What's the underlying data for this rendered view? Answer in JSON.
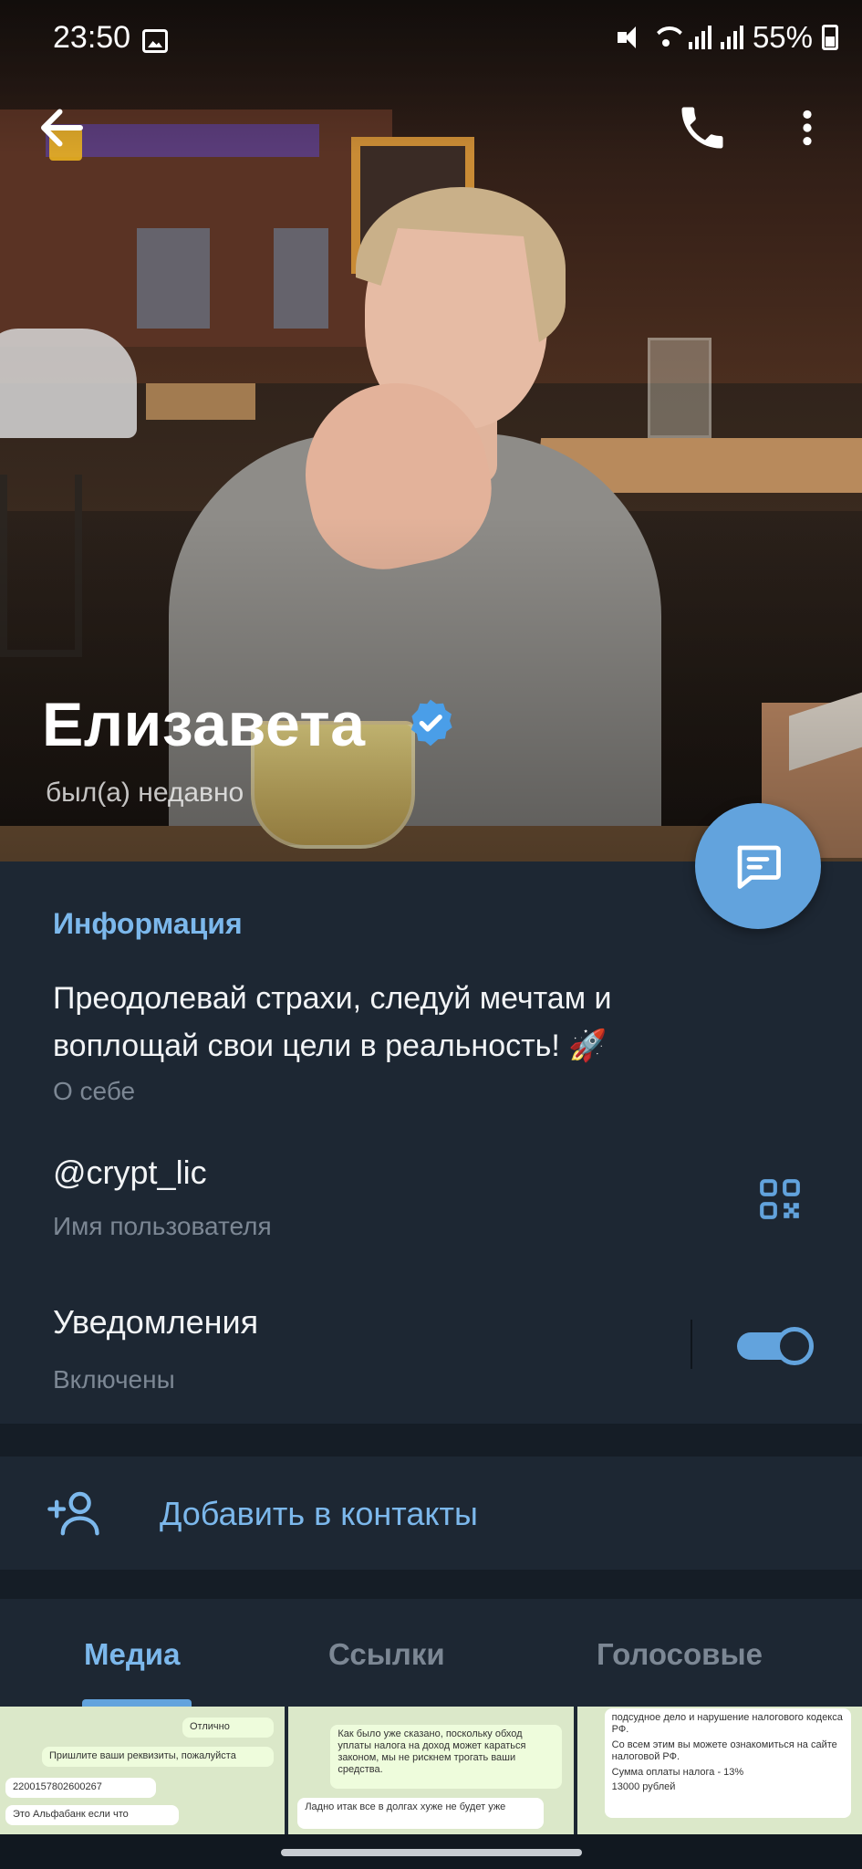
{
  "status_bar": {
    "time": "23:50",
    "battery": "55%",
    "icons": [
      "image-icon",
      "mute-icon",
      "wifi-icon",
      "signal-icon",
      "signal-icon",
      "battery-icon"
    ]
  },
  "profile": {
    "name": "Елизавета",
    "verified": true,
    "last_seen": "был(а) недавно"
  },
  "info": {
    "section_title": "Информация",
    "bio": "Преодолевай страхи, следуй мечтам и воплощай свои цели в реальность! 🚀",
    "bio_label": "О себе",
    "username": "@crypt_lic",
    "username_label": "Имя пользователя",
    "notifications": "Уведомления",
    "notifications_state": "Включены",
    "notifications_on": true
  },
  "actions": {
    "add_contact": "Добавить в контакты"
  },
  "tabs": [
    {
      "label": "Медиа",
      "active": true
    },
    {
      "label": "Ссылки",
      "active": false
    },
    {
      "label": "Голосовые",
      "active": false
    }
  ],
  "media_previews": [
    {
      "lines": [
        "Отлично",
        "Пришлите ваши реквизиты, пожалуйста",
        "2200157802600267",
        "Это Альфабанк если что"
      ]
    },
    {
      "lines": [
        "Как было уже сказано, поскольку обход уплаты налога на доход может караться законом, мы не рискнем трогать ваши средства.",
        "Ладно итак все в долгах хуже не будет уже"
      ]
    },
    {
      "lines": [
        "подсудное дело и нарушение налогового кодекса РФ.",
        "Со всем этим вы можете ознакомиться на сайте налоговой РФ.",
        "Сумма оплаты налога - 13%",
        "13000 рублей"
      ]
    }
  ],
  "colors": {
    "accent": "#62a3dd",
    "accent_text": "#7cb8ec",
    "background": "#1d2733",
    "separator": "#151d26"
  }
}
